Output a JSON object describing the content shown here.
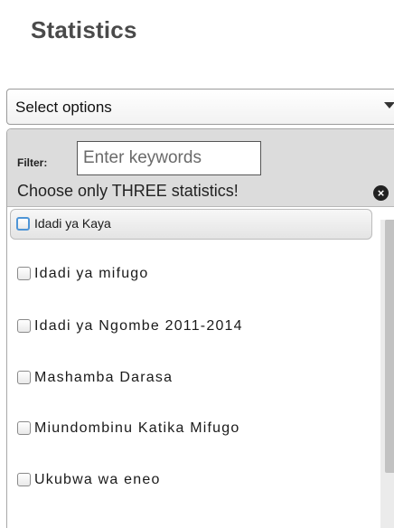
{
  "page": {
    "title": "Statistics"
  },
  "select": {
    "label": "Select options"
  },
  "dropdown": {
    "filter_label": "Filter:",
    "filter_placeholder": "Enter keywords",
    "instruction": "Choose only THREE statistics!",
    "close_icon": "close-circle-icon",
    "options": [
      {
        "label": "Idadi ya Kaya",
        "checked": false,
        "highlighted": true
      },
      {
        "label": "Idadi ya mifugo",
        "checked": false,
        "highlighted": false
      },
      {
        "label": "Idadi ya Ngombe 2011-2014",
        "checked": false,
        "highlighted": false
      },
      {
        "label": "Mashamba Darasa",
        "checked": false,
        "highlighted": false
      },
      {
        "label": "Miundombinu Katika Mifugo",
        "checked": false,
        "highlighted": false
      },
      {
        "label": "Ukubwa wa eneo",
        "checked": false,
        "highlighted": false
      }
    ]
  },
  "colors": {
    "title": "#4a4a4a",
    "header_bg": "#dcdcdc",
    "focus_border": "#4f95d6"
  }
}
